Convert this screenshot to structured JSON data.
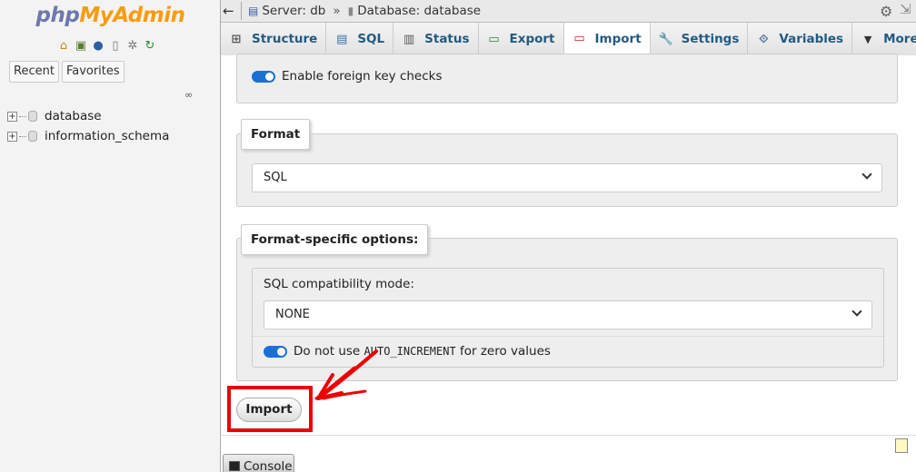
{
  "sidebar": {
    "logo_php": "php",
    "logo_myadmin": "MyAdmin",
    "quick_icons": [
      "home-icon",
      "exit-icon",
      "help-icon",
      "docs-icon",
      "settings-icon",
      "reload-icon"
    ],
    "recent_label": "Recent",
    "favorites_label": "Favorites",
    "tree": [
      {
        "name": "database"
      },
      {
        "name": "information_schema"
      }
    ]
  },
  "topbar": {
    "server_label": "Server: db",
    "separator": "»",
    "database_label": "Database: database"
  },
  "tabs": [
    {
      "label": "Structure",
      "icon": "structure-icon"
    },
    {
      "label": "SQL",
      "icon": "sql-icon"
    },
    {
      "label": "Status",
      "icon": "status-icon"
    },
    {
      "label": "Export",
      "icon": "export-icon"
    },
    {
      "label": "Import",
      "icon": "import-icon",
      "active": true
    },
    {
      "label": "Settings",
      "icon": "wrench-icon"
    },
    {
      "label": "Variables",
      "icon": "variables-icon"
    },
    {
      "label": "More",
      "icon": "caret-down-icon"
    }
  ],
  "main": {
    "fk_checks_label": "Enable foreign key checks",
    "fk_checks_on": true,
    "format_legend": "Format",
    "format_value": "SQL",
    "fso_legend": "Format-specific options:",
    "compat_label": "SQL compatibility mode:",
    "compat_value": "NONE",
    "auto_inc_prefix": "Do not use ",
    "auto_inc_code": "AUTO_INCREMENT",
    "auto_inc_suffix": " for zero values",
    "auto_inc_on": true,
    "import_button": "Import",
    "console_label": "Console"
  },
  "colors": {
    "toggle_on": "#1b70d8",
    "highlight": "#ee0000",
    "tab_text": "#235a81"
  }
}
